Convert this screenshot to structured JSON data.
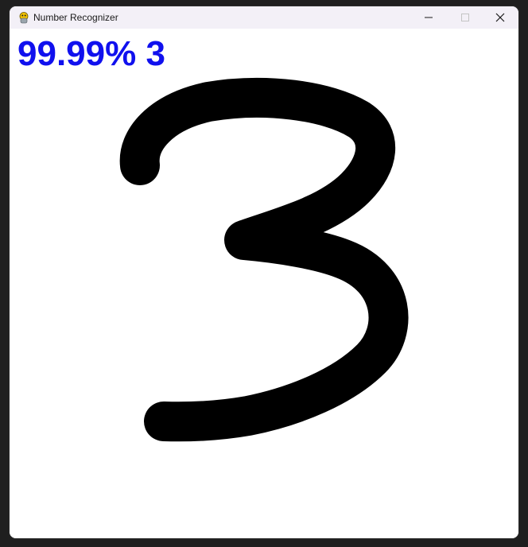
{
  "window": {
    "title": "Number Recognizer",
    "app_icon": "pygame-snake-icon"
  },
  "controls": {
    "minimize_icon": "minimize-icon",
    "maximize_icon": "maximize-icon",
    "close_icon": "close-icon"
  },
  "canvas": {
    "background": "#ffffff",
    "stroke_color": "#000000",
    "drawn_digit": "3"
  },
  "prediction": {
    "confidence": "99.99%",
    "digit": "3",
    "color": "#1010ee"
  }
}
